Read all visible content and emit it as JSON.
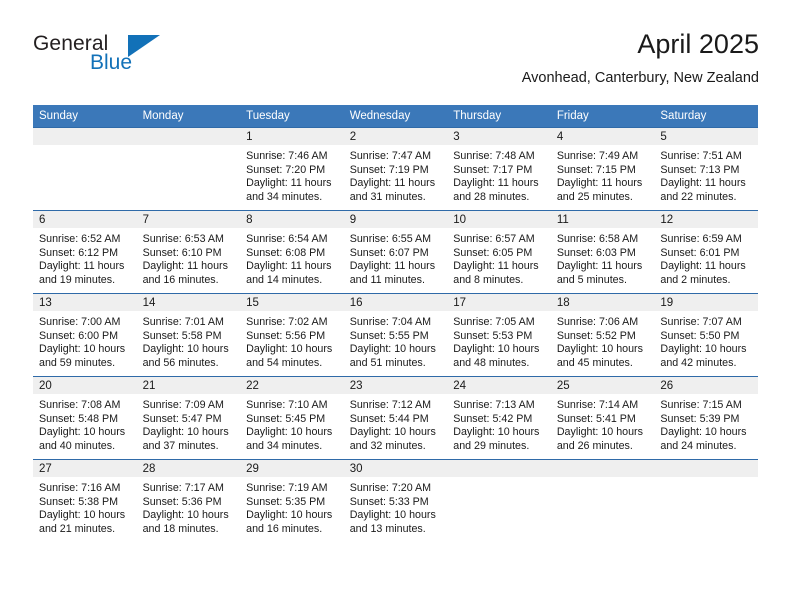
{
  "brand": {
    "name_part1": "General",
    "name_part2": "Blue",
    "logo_icon": "blue-triangle-icon",
    "color_blue": "#1271b8",
    "color_dark": "#231f20"
  },
  "header": {
    "title": "April 2025",
    "subtitle": "Avonhead, Canterbury, New Zealand"
  },
  "theme": {
    "header_bg": "#3b78b9",
    "header_text": "#ffffff",
    "row_divider": "#2f6aa8",
    "date_band_bg": "#efefef",
    "cell_bg": "#ffffff",
    "text": "#1a1a1a"
  },
  "columns": [
    "Sunday",
    "Monday",
    "Tuesday",
    "Wednesday",
    "Thursday",
    "Friday",
    "Saturday"
  ],
  "weeks": [
    [
      {
        "day": "",
        "empty": true
      },
      {
        "day": "",
        "empty": true
      },
      {
        "day": "1",
        "sunrise": "Sunrise: 7:46 AM",
        "sunset": "Sunset: 7:20 PM",
        "daylight_line1": "Daylight: 11 hours",
        "daylight_line2": "and 34 minutes."
      },
      {
        "day": "2",
        "sunrise": "Sunrise: 7:47 AM",
        "sunset": "Sunset: 7:19 PM",
        "daylight_line1": "Daylight: 11 hours",
        "daylight_line2": "and 31 minutes."
      },
      {
        "day": "3",
        "sunrise": "Sunrise: 7:48 AM",
        "sunset": "Sunset: 7:17 PM",
        "daylight_line1": "Daylight: 11 hours",
        "daylight_line2": "and 28 minutes."
      },
      {
        "day": "4",
        "sunrise": "Sunrise: 7:49 AM",
        "sunset": "Sunset: 7:15 PM",
        "daylight_line1": "Daylight: 11 hours",
        "daylight_line2": "and 25 minutes."
      },
      {
        "day": "5",
        "sunrise": "Sunrise: 7:51 AM",
        "sunset": "Sunset: 7:13 PM",
        "daylight_line1": "Daylight: 11 hours",
        "daylight_line2": "and 22 minutes."
      }
    ],
    [
      {
        "day": "6",
        "sunrise": "Sunrise: 6:52 AM",
        "sunset": "Sunset: 6:12 PM",
        "daylight_line1": "Daylight: 11 hours",
        "daylight_line2": "and 19 minutes."
      },
      {
        "day": "7",
        "sunrise": "Sunrise: 6:53 AM",
        "sunset": "Sunset: 6:10 PM",
        "daylight_line1": "Daylight: 11 hours",
        "daylight_line2": "and 16 minutes."
      },
      {
        "day": "8",
        "sunrise": "Sunrise: 6:54 AM",
        "sunset": "Sunset: 6:08 PM",
        "daylight_line1": "Daylight: 11 hours",
        "daylight_line2": "and 14 minutes."
      },
      {
        "day": "9",
        "sunrise": "Sunrise: 6:55 AM",
        "sunset": "Sunset: 6:07 PM",
        "daylight_line1": "Daylight: 11 hours",
        "daylight_line2": "and 11 minutes."
      },
      {
        "day": "10",
        "sunrise": "Sunrise: 6:57 AM",
        "sunset": "Sunset: 6:05 PM",
        "daylight_line1": "Daylight: 11 hours",
        "daylight_line2": "and 8 minutes."
      },
      {
        "day": "11",
        "sunrise": "Sunrise: 6:58 AM",
        "sunset": "Sunset: 6:03 PM",
        "daylight_line1": "Daylight: 11 hours",
        "daylight_line2": "and 5 minutes."
      },
      {
        "day": "12",
        "sunrise": "Sunrise: 6:59 AM",
        "sunset": "Sunset: 6:01 PM",
        "daylight_line1": "Daylight: 11 hours",
        "daylight_line2": "and 2 minutes."
      }
    ],
    [
      {
        "day": "13",
        "sunrise": "Sunrise: 7:00 AM",
        "sunset": "Sunset: 6:00 PM",
        "daylight_line1": "Daylight: 10 hours",
        "daylight_line2": "and 59 minutes."
      },
      {
        "day": "14",
        "sunrise": "Sunrise: 7:01 AM",
        "sunset": "Sunset: 5:58 PM",
        "daylight_line1": "Daylight: 10 hours",
        "daylight_line2": "and 56 minutes."
      },
      {
        "day": "15",
        "sunrise": "Sunrise: 7:02 AM",
        "sunset": "Sunset: 5:56 PM",
        "daylight_line1": "Daylight: 10 hours",
        "daylight_line2": "and 54 minutes."
      },
      {
        "day": "16",
        "sunrise": "Sunrise: 7:04 AM",
        "sunset": "Sunset: 5:55 PM",
        "daylight_line1": "Daylight: 10 hours",
        "daylight_line2": "and 51 minutes."
      },
      {
        "day": "17",
        "sunrise": "Sunrise: 7:05 AM",
        "sunset": "Sunset: 5:53 PM",
        "daylight_line1": "Daylight: 10 hours",
        "daylight_line2": "and 48 minutes."
      },
      {
        "day": "18",
        "sunrise": "Sunrise: 7:06 AM",
        "sunset": "Sunset: 5:52 PM",
        "daylight_line1": "Daylight: 10 hours",
        "daylight_line2": "and 45 minutes."
      },
      {
        "day": "19",
        "sunrise": "Sunrise: 7:07 AM",
        "sunset": "Sunset: 5:50 PM",
        "daylight_line1": "Daylight: 10 hours",
        "daylight_line2": "and 42 minutes."
      }
    ],
    [
      {
        "day": "20",
        "sunrise": "Sunrise: 7:08 AM",
        "sunset": "Sunset: 5:48 PM",
        "daylight_line1": "Daylight: 10 hours",
        "daylight_line2": "and 40 minutes."
      },
      {
        "day": "21",
        "sunrise": "Sunrise: 7:09 AM",
        "sunset": "Sunset: 5:47 PM",
        "daylight_line1": "Daylight: 10 hours",
        "daylight_line2": "and 37 minutes."
      },
      {
        "day": "22",
        "sunrise": "Sunrise: 7:10 AM",
        "sunset": "Sunset: 5:45 PM",
        "daylight_line1": "Daylight: 10 hours",
        "daylight_line2": "and 34 minutes."
      },
      {
        "day": "23",
        "sunrise": "Sunrise: 7:12 AM",
        "sunset": "Sunset: 5:44 PM",
        "daylight_line1": "Daylight: 10 hours",
        "daylight_line2": "and 32 minutes."
      },
      {
        "day": "24",
        "sunrise": "Sunrise: 7:13 AM",
        "sunset": "Sunset: 5:42 PM",
        "daylight_line1": "Daylight: 10 hours",
        "daylight_line2": "and 29 minutes."
      },
      {
        "day": "25",
        "sunrise": "Sunrise: 7:14 AM",
        "sunset": "Sunset: 5:41 PM",
        "daylight_line1": "Daylight: 10 hours",
        "daylight_line2": "and 26 minutes."
      },
      {
        "day": "26",
        "sunrise": "Sunrise: 7:15 AM",
        "sunset": "Sunset: 5:39 PM",
        "daylight_line1": "Daylight: 10 hours",
        "daylight_line2": "and 24 minutes."
      }
    ],
    [
      {
        "day": "27",
        "sunrise": "Sunrise: 7:16 AM",
        "sunset": "Sunset: 5:38 PM",
        "daylight_line1": "Daylight: 10 hours",
        "daylight_line2": "and 21 minutes."
      },
      {
        "day": "28",
        "sunrise": "Sunrise: 7:17 AM",
        "sunset": "Sunset: 5:36 PM",
        "daylight_line1": "Daylight: 10 hours",
        "daylight_line2": "and 18 minutes."
      },
      {
        "day": "29",
        "sunrise": "Sunrise: 7:19 AM",
        "sunset": "Sunset: 5:35 PM",
        "daylight_line1": "Daylight: 10 hours",
        "daylight_line2": "and 16 minutes."
      },
      {
        "day": "30",
        "sunrise": "Sunrise: 7:20 AM",
        "sunset": "Sunset: 5:33 PM",
        "daylight_line1": "Daylight: 10 hours",
        "daylight_line2": "and 13 minutes."
      },
      {
        "day": "",
        "empty": true
      },
      {
        "day": "",
        "empty": true
      },
      {
        "day": "",
        "empty": true
      }
    ]
  ]
}
